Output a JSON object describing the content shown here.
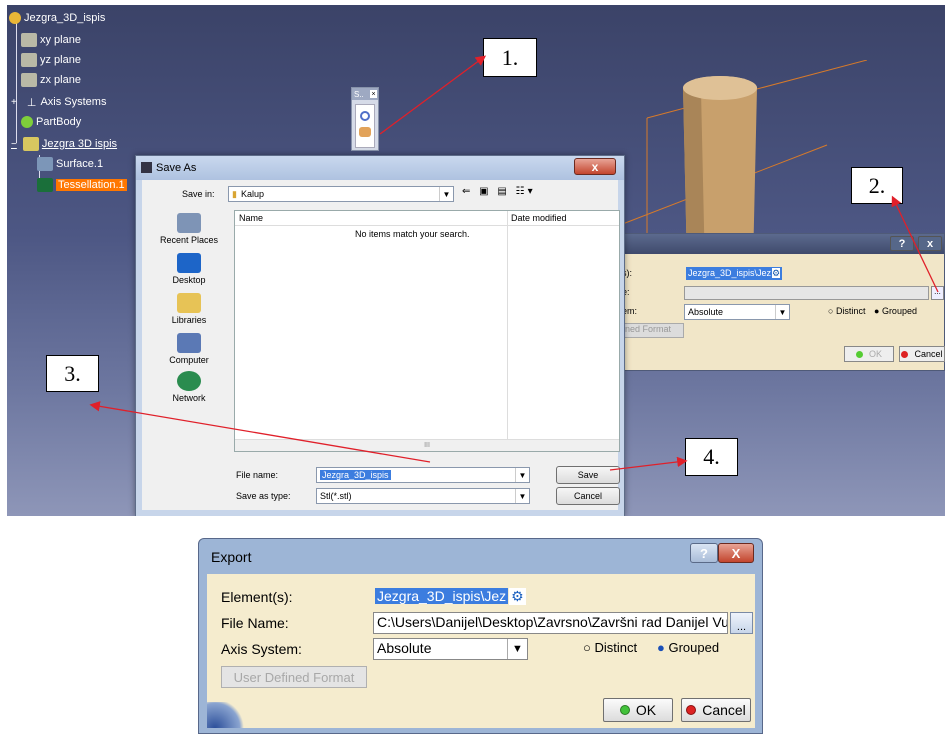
{
  "tree": {
    "root": "Jezgra_3D_ispis",
    "items": [
      "xy plane",
      "yz plane",
      "zx plane",
      "Axis Systems",
      "PartBody",
      "Jezgra 3D ispis",
      "Surface.1",
      "Tessellation.1"
    ]
  },
  "toolbar_mini": {
    "title": "S.."
  },
  "callouts": [
    "1.",
    "2.",
    "3.",
    "4."
  ],
  "saveas": {
    "title": "Save As",
    "save_in_label": "Save in:",
    "save_in_value": "Kalup",
    "places": [
      "Recent Places",
      "Desktop",
      "Libraries",
      "Computer",
      "Network"
    ],
    "col_name": "Name",
    "col_date": "Date modified",
    "empty_msg": "No items match your search.",
    "file_name_label": "File name:",
    "file_name_value": "Jezgra_3D_ispis",
    "save_type_label": "Save as type:",
    "save_type_value": "Stl(*.stl)",
    "save_btn": "Save",
    "cancel_btn": "Cancel",
    "scroll_mark": "III",
    "close": "x"
  },
  "bg_export": {
    "help": "?",
    "close": "x",
    "row1_label": "s):",
    "element_value": "Jezgra_3D_ispis\\Jez",
    "row2_label": "e:",
    "browse": "...",
    "row3_label": "em:",
    "axis_value": "Absolute",
    "distinct": "Distinct",
    "grouped": "Grouped",
    "udf": "ned Format",
    "ok": "OK",
    "cancel": "Cancel"
  },
  "export": {
    "title": "Export",
    "help": "?",
    "close": "X",
    "element_label": "Element(s):",
    "element_value": "Jezgra_3D_ispis\\Jez",
    "file_label": "File Name:",
    "file_value": "C:\\Users\\Danijel\\Desktop\\Zavrsno\\Završni rad Danijel Vu",
    "browse": "...",
    "axis_label": "Axis System:",
    "axis_value": "Absolute",
    "distinct": "Distinct",
    "grouped": "Grouped",
    "udf": "User Defined Format",
    "ok": "OK",
    "cancel": "Cancel"
  },
  "colors": {
    "selection": "#ff7700",
    "highlight": "#3c7ddf",
    "arrow": "#e0202a"
  }
}
